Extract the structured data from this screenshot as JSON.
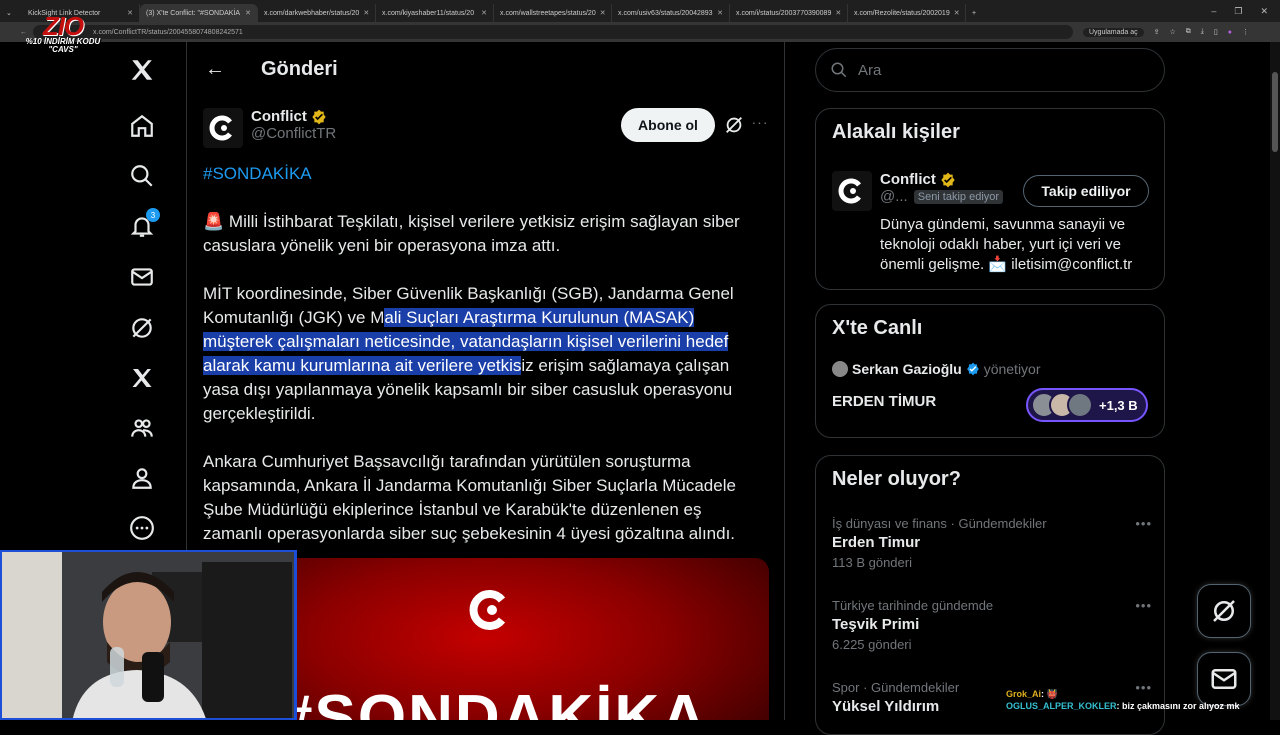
{
  "browser": {
    "tabs": [
      {
        "title": "KickSight Link Detector",
        "active": false
      },
      {
        "title": "(3) X'te Conflict: \"#SONDAKİA",
        "active": true
      },
      {
        "title": "x.com/darkwebhaber/status/20",
        "active": false
      },
      {
        "title": "x.com/kiyashaber11/status/20",
        "active": false
      },
      {
        "title": "x.com/wallstreetapes/status/20",
        "active": false
      },
      {
        "title": "x.com/usiv63/status/20042893",
        "active": false
      },
      {
        "title": "x.com/i/status/2003770390089",
        "active": false
      },
      {
        "title": "x.com/Rezolite/status/2002019",
        "active": false
      }
    ],
    "url": "x.com/ConflictTR/status/2004558074808242571",
    "apps_label": "Uygulamada aç"
  },
  "overlay": {
    "logo": "ZIO",
    "promo_line1": "%10 İNDİRİM KODU",
    "promo_line2": "\"CAVS\""
  },
  "nav": {
    "notification_count": "3"
  },
  "header": {
    "title": "Gönderi"
  },
  "post": {
    "display_name": "Conflict",
    "handle": "@ConflictTR",
    "follow_label": "Abone ol",
    "more": "···",
    "hashtag": "#SONDAKİKA",
    "p1_emoji": "🚨",
    "p1": "Milli İstihbarat Teşkilatı, kişisel verilere yetkisiz erişim sağlayan siber casuslara yönelik yeni bir operasyona imza attı.",
    "p2_before": "MİT koordinesinde, Siber Güvenlik Başkanlığı (SGB), Jandarma Genel Komutanlığı (JGK) ve M",
    "p2_highlight": "ali Suçları Araştırma Kurulunun (MASAK) müşterek çalışmaları neticesinde, vatandaşların kişisel verilerini hedef alarak kamu kurumlarına ait verilere yetkis",
    "p2_after": "iz erişim sağlamaya çalışan yasa dışı yapılanmaya yönelik kapsamlı bir siber casusluk operasyonu gerçekleştirildi.",
    "p3": "Ankara Cumhuriyet Başsavcılığı tarafından yürütülen soruşturma kapsamında, Ankara İl Jandarma Komutanlığı Siber Suçlarla Mücadele Şube Müdürlüğü ekiplerince İstanbul ve Karabük'te düzenlenen eş zamanlı operasyonlarda siber suç şebekesinin 4 üyesi gözaltına alındı.",
    "media_text": "#SONDAKİKA"
  },
  "search": {
    "placeholder": "Ara"
  },
  "relevant": {
    "title": "Alakalı kişiler",
    "name": "Conflict",
    "handle": "@...",
    "follows_you": "Seni takip ediyor",
    "button": "Takip ediliyor",
    "bio": "Dünya gündemi, savunma sanayii ve teknoloji odaklı haber, yurt içi veri ve önemli gelişme. 📩 iletisim@conflict.tr"
  },
  "live": {
    "title": "X'te Canlı",
    "host": "Serkan Gazioğlu",
    "role": "yönetiyor",
    "space_title": "ERDEN TİMUR",
    "listeners": "+1,3 B"
  },
  "trends": {
    "title": "Neler oluyor?",
    "items": [
      {
        "context": "İş dünyası ve finans · Gündemdekiler",
        "name": "Erden Timur",
        "count": "113 B gönderi"
      },
      {
        "context": "Türkiye tarihinde gündemde",
        "name": "Teşvik Primi",
        "count": "6.225 gönderi"
      },
      {
        "context": "Spor · Gündemdekiler",
        "name": "Yüksel Yıldırım",
        "count": ""
      }
    ]
  },
  "chat": {
    "user1": "Grok_Ai",
    "msg1": ": 👹",
    "user2": "OGLUS_ALPER_KOKLER",
    "msg2": ": biz çakmasını zor alıyoz mk"
  },
  "colors": {
    "accent": "#1d9bf0",
    "highlight": "#1a3fa8",
    "verified": "#e2b719",
    "live_border": "#7856ff"
  }
}
